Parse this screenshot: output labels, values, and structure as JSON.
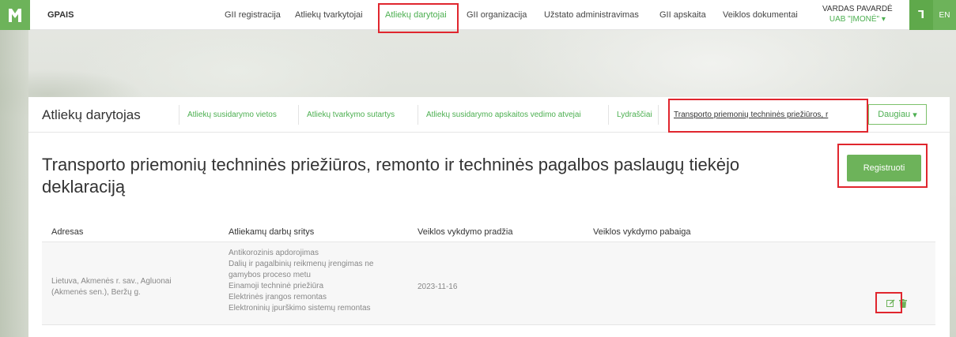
{
  "app": {
    "brand": "GPAIS"
  },
  "topnav": {
    "items": [
      "GII registracija",
      "Atliekų tvarkytojai",
      "Atliekų darytojai",
      "GII organizacija",
      "Užstato administravimas",
      "GII apskaita",
      "Veiklos dokumentai"
    ],
    "active": "Atliekų darytojai"
  },
  "user": {
    "name": "VARDAS PAVARDĖ",
    "org": "UAB \"ĮMONĖ\""
  },
  "font_button": "Ꞁ",
  "lang_button": "EN",
  "subnav": {
    "title": "Atliekų darytojas",
    "links": [
      "Atliekų susidarymo vietos",
      "Atliekų tvarkymo sutartys",
      "Atliekų susidarymo apskaitos vedimo atvejai",
      "Lydraščiai",
      "Transporto priemonių techninės priežiūros, r"
    ],
    "more": "Daugiau"
  },
  "page": {
    "title": "Transporto priemonių techninės priežiūros, remonto ir techninės pagalbos paslaugų tiekėjo deklaraciją",
    "register": "Registruoti"
  },
  "table": {
    "headers": [
      "Adresas",
      "Atliekamų darbų sritys",
      "Veiklos vykdymo pradžia",
      "Veiklos vykdymo pabaiga"
    ],
    "rows": [
      {
        "address_1": "Lietuva, Akmenės r. sav., Agluonai",
        "address_2": "(Akmenės sen.), Beržų g.",
        "works": [
          "Antikorozinis apdorojimas",
          "Dalių ir pagalbinių reikmenų įrengimas ne",
          "gamybos proceso metu",
          "Einamoji techninė priežiūra",
          "Elektrinės įrangos remontas",
          "Elektroninių įpurškimo sistemų remontas"
        ],
        "start": "2023-11-16",
        "end": ""
      }
    ]
  },
  "colors": {
    "accent": "#6db35a",
    "highlight": "#e0262e"
  },
  "icons": [
    "logo-icon",
    "edit-icon",
    "delete-icon",
    "caret-down-icon"
  ]
}
